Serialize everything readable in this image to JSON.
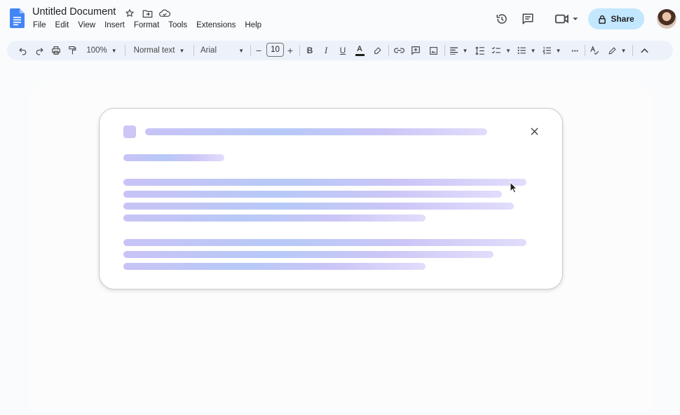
{
  "document": {
    "title": "Untitled Document"
  },
  "menu": [
    "File",
    "Edit",
    "View",
    "Insert",
    "Format",
    "Tools",
    "Extensions",
    "Help"
  ],
  "title_icons": [
    "star-icon",
    "move-to-folder-icon",
    "cloud-saved-icon"
  ],
  "header_right": {
    "icons": [
      "version-history-icon",
      "comments-icon",
      "meet-icon"
    ],
    "share_label": "Share",
    "share_icon": "lock-icon"
  },
  "toolbar": {
    "zoom": "100%",
    "style": "Normal text",
    "font": "Arial",
    "font_size": "10",
    "bold": "B",
    "italic": "I",
    "underline": "U",
    "text_color": "A",
    "icons": [
      "undo-icon",
      "redo-icon",
      "print-icon",
      "paint-format-icon",
      "highlight-icon",
      "link-icon",
      "add-comment-icon",
      "insert-image-icon",
      "align-icon",
      "line-spacing-icon",
      "checklist-icon",
      "bulleted-list-icon",
      "numbered-list-icon",
      "more-icon",
      "spelling-icon",
      "editing-mode-icon",
      "collapse-icon"
    ]
  },
  "colors": {
    "share_bg": "#c2e7ff",
    "toolbar_bg": "#edf2fa",
    "skeleton": "#c8c3f6",
    "doc_blue": "#4285f4"
  }
}
